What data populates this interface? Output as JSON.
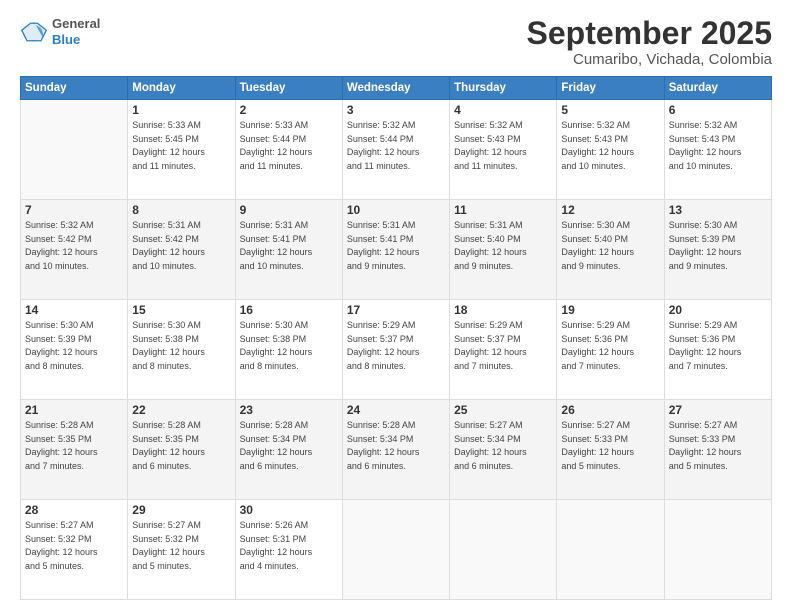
{
  "header": {
    "logo_general": "General",
    "logo_blue": "Blue",
    "title": "September 2025",
    "subtitle": "Cumaribo, Vichada, Colombia"
  },
  "days_of_week": [
    "Sunday",
    "Monday",
    "Tuesday",
    "Wednesday",
    "Thursday",
    "Friday",
    "Saturday"
  ],
  "weeks": [
    [
      {
        "day": "",
        "info": ""
      },
      {
        "day": "1",
        "info": "Sunrise: 5:33 AM\nSunset: 5:45 PM\nDaylight: 12 hours\nand 11 minutes."
      },
      {
        "day": "2",
        "info": "Sunrise: 5:33 AM\nSunset: 5:44 PM\nDaylight: 12 hours\nand 11 minutes."
      },
      {
        "day": "3",
        "info": "Sunrise: 5:32 AM\nSunset: 5:44 PM\nDaylight: 12 hours\nand 11 minutes."
      },
      {
        "day": "4",
        "info": "Sunrise: 5:32 AM\nSunset: 5:43 PM\nDaylight: 12 hours\nand 11 minutes."
      },
      {
        "day": "5",
        "info": "Sunrise: 5:32 AM\nSunset: 5:43 PM\nDaylight: 12 hours\nand 10 minutes."
      },
      {
        "day": "6",
        "info": "Sunrise: 5:32 AM\nSunset: 5:43 PM\nDaylight: 12 hours\nand 10 minutes."
      }
    ],
    [
      {
        "day": "7",
        "info": "Sunrise: 5:32 AM\nSunset: 5:42 PM\nDaylight: 12 hours\nand 10 minutes."
      },
      {
        "day": "8",
        "info": "Sunrise: 5:31 AM\nSunset: 5:42 PM\nDaylight: 12 hours\nand 10 minutes."
      },
      {
        "day": "9",
        "info": "Sunrise: 5:31 AM\nSunset: 5:41 PM\nDaylight: 12 hours\nand 10 minutes."
      },
      {
        "day": "10",
        "info": "Sunrise: 5:31 AM\nSunset: 5:41 PM\nDaylight: 12 hours\nand 9 minutes."
      },
      {
        "day": "11",
        "info": "Sunrise: 5:31 AM\nSunset: 5:40 PM\nDaylight: 12 hours\nand 9 minutes."
      },
      {
        "day": "12",
        "info": "Sunrise: 5:30 AM\nSunset: 5:40 PM\nDaylight: 12 hours\nand 9 minutes."
      },
      {
        "day": "13",
        "info": "Sunrise: 5:30 AM\nSunset: 5:39 PM\nDaylight: 12 hours\nand 9 minutes."
      }
    ],
    [
      {
        "day": "14",
        "info": "Sunrise: 5:30 AM\nSunset: 5:39 PM\nDaylight: 12 hours\nand 8 minutes."
      },
      {
        "day": "15",
        "info": "Sunrise: 5:30 AM\nSunset: 5:38 PM\nDaylight: 12 hours\nand 8 minutes."
      },
      {
        "day": "16",
        "info": "Sunrise: 5:30 AM\nSunset: 5:38 PM\nDaylight: 12 hours\nand 8 minutes."
      },
      {
        "day": "17",
        "info": "Sunrise: 5:29 AM\nSunset: 5:37 PM\nDaylight: 12 hours\nand 8 minutes."
      },
      {
        "day": "18",
        "info": "Sunrise: 5:29 AM\nSunset: 5:37 PM\nDaylight: 12 hours\nand 7 minutes."
      },
      {
        "day": "19",
        "info": "Sunrise: 5:29 AM\nSunset: 5:36 PM\nDaylight: 12 hours\nand 7 minutes."
      },
      {
        "day": "20",
        "info": "Sunrise: 5:29 AM\nSunset: 5:36 PM\nDaylight: 12 hours\nand 7 minutes."
      }
    ],
    [
      {
        "day": "21",
        "info": "Sunrise: 5:28 AM\nSunset: 5:35 PM\nDaylight: 12 hours\nand 7 minutes."
      },
      {
        "day": "22",
        "info": "Sunrise: 5:28 AM\nSunset: 5:35 PM\nDaylight: 12 hours\nand 6 minutes."
      },
      {
        "day": "23",
        "info": "Sunrise: 5:28 AM\nSunset: 5:34 PM\nDaylight: 12 hours\nand 6 minutes."
      },
      {
        "day": "24",
        "info": "Sunrise: 5:28 AM\nSunset: 5:34 PM\nDaylight: 12 hours\nand 6 minutes."
      },
      {
        "day": "25",
        "info": "Sunrise: 5:27 AM\nSunset: 5:34 PM\nDaylight: 12 hours\nand 6 minutes."
      },
      {
        "day": "26",
        "info": "Sunrise: 5:27 AM\nSunset: 5:33 PM\nDaylight: 12 hours\nand 5 minutes."
      },
      {
        "day": "27",
        "info": "Sunrise: 5:27 AM\nSunset: 5:33 PM\nDaylight: 12 hours\nand 5 minutes."
      }
    ],
    [
      {
        "day": "28",
        "info": "Sunrise: 5:27 AM\nSunset: 5:32 PM\nDaylight: 12 hours\nand 5 minutes."
      },
      {
        "day": "29",
        "info": "Sunrise: 5:27 AM\nSunset: 5:32 PM\nDaylight: 12 hours\nand 5 minutes."
      },
      {
        "day": "30",
        "info": "Sunrise: 5:26 AM\nSunset: 5:31 PM\nDaylight: 12 hours\nand 4 minutes."
      },
      {
        "day": "",
        "info": ""
      },
      {
        "day": "",
        "info": ""
      },
      {
        "day": "",
        "info": ""
      },
      {
        "day": "",
        "info": ""
      }
    ]
  ]
}
